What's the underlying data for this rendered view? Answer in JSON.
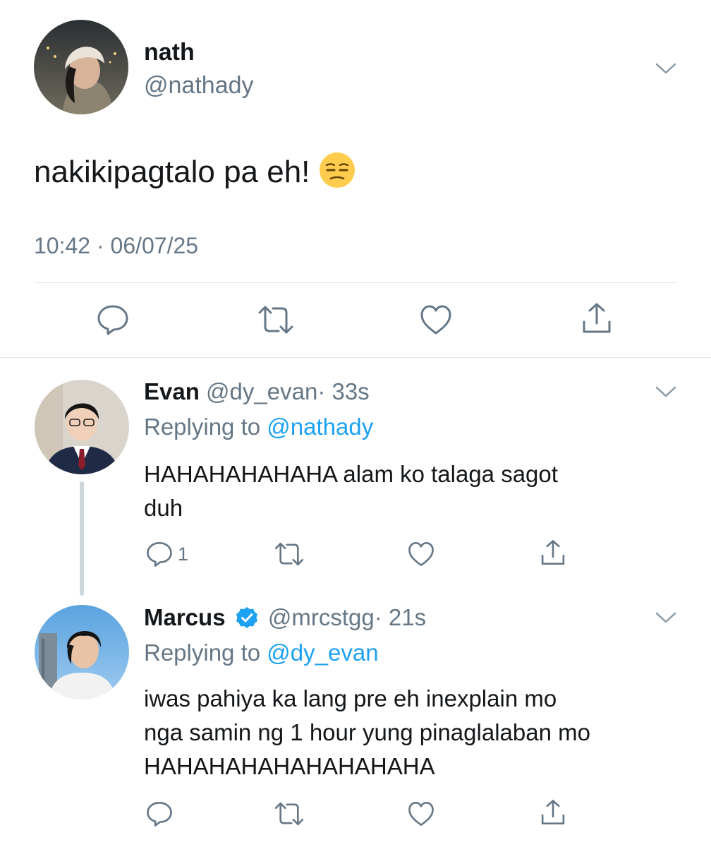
{
  "main_tweet": {
    "display_name": "nath",
    "handle": "@nathady",
    "text": "nakikipagtalo pa eh!",
    "emoji": "unamused-face",
    "timestamp": "10:42 · 06/07/25"
  },
  "replies": [
    {
      "display_name": "Evan",
      "handle": "@dy_evan",
      "time": "· 33s",
      "replying_prefix": "Replying to",
      "replying_to": "@nathady",
      "text_lines": [
        "HAHAHAHAHAHA alam ko talaga sagot",
        "duh"
      ],
      "reply_count": "1",
      "verified": false
    },
    {
      "display_name": "Marcus",
      "handle": "@mrcstgg",
      "time": "· 21s",
      "replying_prefix": "Replying to",
      "replying_to": "@dy_evan",
      "text_lines": [
        "iwas pahiya ka lang pre eh inexplain mo",
        "nga samin ng 1 hour yung pinaglalaban mo",
        "HAHAHAHAHAHAHAHAHA"
      ],
      "reply_count": "",
      "verified": true
    }
  ],
  "icons": [
    "reply-icon",
    "retweet-icon",
    "like-icon",
    "share-icon",
    "chevron-down-icon",
    "verified-badge-icon"
  ],
  "colors": {
    "accent": "#1da1f2",
    "muted": "#657786",
    "text": "#14171a",
    "divider": "#e1e8ed"
  }
}
